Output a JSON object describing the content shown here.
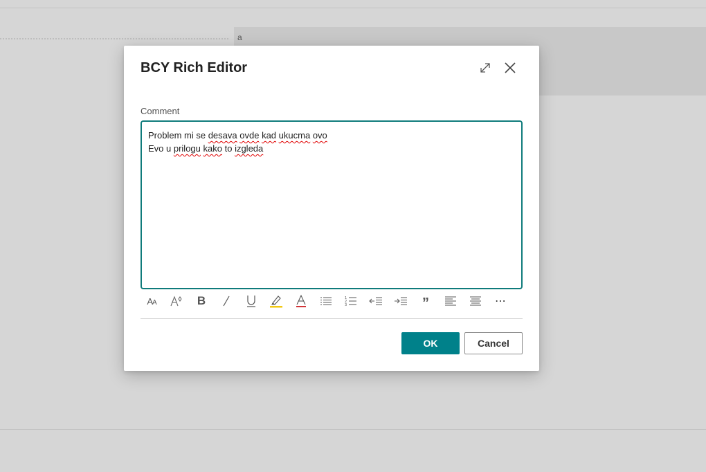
{
  "background": {
    "panel_text": "a"
  },
  "dialog": {
    "title": "BCY Rich Editor",
    "expand_icon": "expand-icon",
    "close_icon": "close-icon",
    "field_label": "Comment",
    "editor": {
      "line1": {
        "w1": "Problem mi se ",
        "w2": "desava",
        "w3": " ",
        "w4": "ovde",
        "w5": " ",
        "w6": "kad",
        "w7": " ",
        "w8": "ukucma",
        "w9": " ",
        "w10": "ovo"
      },
      "line2": {
        "w1": "Evo u ",
        "w2": "prilogu",
        "w3": " ",
        "w4": "kako",
        "w5": " to ",
        "w6": "izgleda"
      }
    },
    "toolbar": {
      "font_size": "AA",
      "font_grow": "A",
      "bold": "B",
      "italic": "/",
      "underline": "U",
      "font_color": "A",
      "quote": "”",
      "more": "⋯",
      "highlight_color": "#f2c811",
      "font_color_bar": "#d13438"
    },
    "ok_label": "OK",
    "cancel_label": "Cancel",
    "accent_color": "#00818a"
  }
}
